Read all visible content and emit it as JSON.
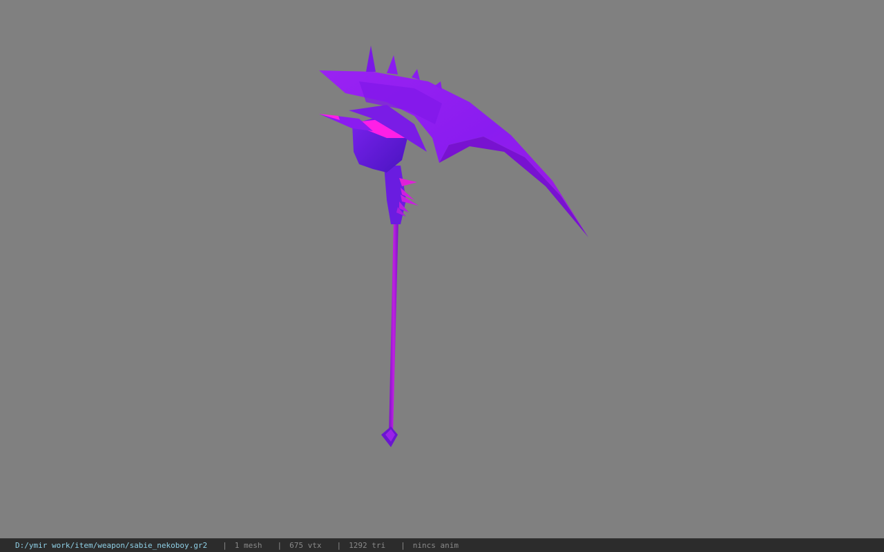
{
  "viewer": {
    "background_color": "#808080",
    "model": {
      "name": "scythe-weapon-model",
      "colors": {
        "main": "#8a1cf0",
        "dark": "#5a18d6",
        "highlight": "#ff1fe6",
        "shaft": "#a51cd8"
      }
    }
  },
  "status_bar": {
    "path": "D:/ymir work/item/weapon/sabie_nekoboy.gr2",
    "separator": "|",
    "mesh": "1 mesh",
    "vertices": "675 vtx",
    "triangles": "1292 tri",
    "anim": "nincs anim"
  }
}
